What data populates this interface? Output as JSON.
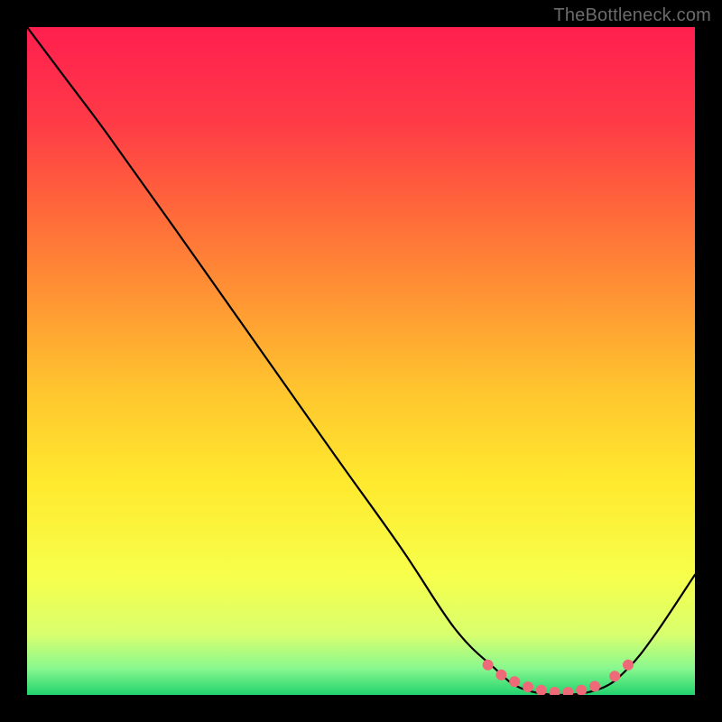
{
  "watermark": {
    "text": "TheBottleneck.com"
  },
  "gradient": {
    "stops": [
      {
        "pct": 0,
        "color": "#ff1f4f"
      },
      {
        "pct": 14,
        "color": "#ff3a47"
      },
      {
        "pct": 28,
        "color": "#ff6a3a"
      },
      {
        "pct": 42,
        "color": "#ff9a33"
      },
      {
        "pct": 55,
        "color": "#ffc72e"
      },
      {
        "pct": 68,
        "color": "#ffe92e"
      },
      {
        "pct": 82,
        "color": "#f7ff4a"
      },
      {
        "pct": 91,
        "color": "#d8ff6e"
      },
      {
        "pct": 96,
        "color": "#89f88f"
      },
      {
        "pct": 100,
        "color": "#22d36e"
      }
    ]
  },
  "chart_data": {
    "type": "line",
    "title": "",
    "xlabel": "",
    "ylabel": "",
    "x_range": [
      0,
      100
    ],
    "y_range": [
      0,
      100
    ],
    "series": [
      {
        "name": "bottleneck-curve",
        "color": "#000000",
        "points": [
          {
            "x": 0,
            "y": 100
          },
          {
            "x": 6,
            "y": 92
          },
          {
            "x": 12,
            "y": 84
          },
          {
            "x": 22,
            "y": 70
          },
          {
            "x": 34,
            "y": 53
          },
          {
            "x": 46,
            "y": 36
          },
          {
            "x": 56,
            "y": 22
          },
          {
            "x": 64,
            "y": 10
          },
          {
            "x": 70,
            "y": 4
          },
          {
            "x": 74,
            "y": 1
          },
          {
            "x": 80,
            "y": 0
          },
          {
            "x": 86,
            "y": 1
          },
          {
            "x": 90,
            "y": 4
          },
          {
            "x": 94,
            "y": 9
          },
          {
            "x": 100,
            "y": 18
          }
        ]
      }
    ],
    "markers": {
      "name": "highlight-dots",
      "color": "#ef6a78",
      "radius": 6,
      "points": [
        {
          "x": 69,
          "y": 4.5
        },
        {
          "x": 71,
          "y": 3.0
        },
        {
          "x": 73,
          "y": 2.0
        },
        {
          "x": 75,
          "y": 1.2
        },
        {
          "x": 77,
          "y": 0.7
        },
        {
          "x": 79,
          "y": 0.4
        },
        {
          "x": 81,
          "y": 0.4
        },
        {
          "x": 83,
          "y": 0.7
        },
        {
          "x": 85,
          "y": 1.3
        },
        {
          "x": 88,
          "y": 2.8
        },
        {
          "x": 90,
          "y": 4.5
        }
      ]
    }
  }
}
